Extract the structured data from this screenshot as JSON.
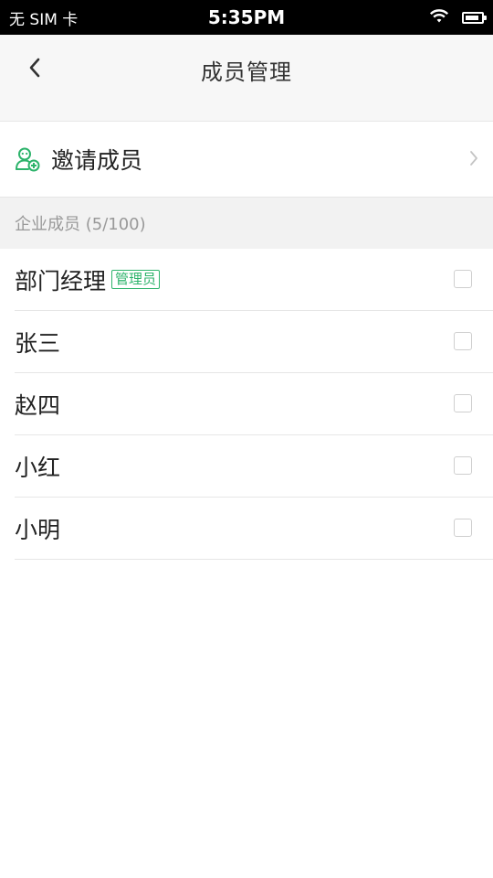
{
  "status_bar": {
    "carrier": "无 SIM 卡",
    "time": "5:35PM",
    "icons": [
      "wifi-icon",
      "battery-icon"
    ],
    "battery_level": 0.85
  },
  "nav": {
    "title": "成员管理",
    "back_icon": "chevron-left-icon"
  },
  "invite": {
    "label": "邀请成员",
    "icon": "add-user-icon",
    "chevron_icon": "chevron-right-icon"
  },
  "section": {
    "header": "企业成员 (5/100)"
  },
  "members": [
    {
      "name": "部门经理",
      "badge": "管理员",
      "checked": false
    },
    {
      "name": "张三",
      "badge": "",
      "checked": false
    },
    {
      "name": "赵四",
      "badge": "",
      "checked": false
    },
    {
      "name": "小红",
      "badge": "",
      "checked": false
    },
    {
      "name": "小明",
      "badge": "",
      "checked": false
    }
  ],
  "colors": {
    "accent_green": "#2db36b",
    "status_bar_bg": "#000000",
    "nav_bg": "#f7f7f7",
    "section_bg": "#f2f2f2"
  }
}
